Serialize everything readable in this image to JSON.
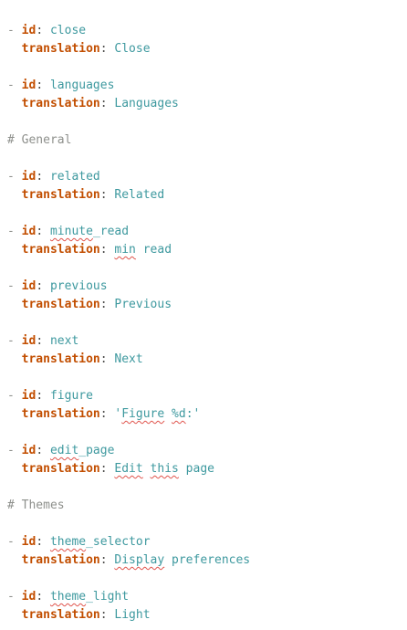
{
  "editor": {
    "lines": [
      {
        "type": "id",
        "value": "close"
      },
      {
        "type": "translation",
        "value": "Close"
      },
      {
        "type": "blank"
      },
      {
        "type": "id",
        "value": "languages"
      },
      {
        "type": "translation",
        "value": "Languages"
      },
      {
        "type": "blank"
      },
      {
        "type": "comment",
        "value": "# General"
      },
      {
        "type": "blank"
      },
      {
        "type": "id",
        "value": "related"
      },
      {
        "type": "translation",
        "value": "Related"
      },
      {
        "type": "blank"
      },
      {
        "type": "id",
        "value": "minute_read",
        "spellcheck": [
          "minute"
        ]
      },
      {
        "type": "translation",
        "value": "min read",
        "spellcheck": [
          "min"
        ]
      },
      {
        "type": "blank"
      },
      {
        "type": "id",
        "value": "previous"
      },
      {
        "type": "translation",
        "value": "Previous"
      },
      {
        "type": "blank"
      },
      {
        "type": "id",
        "value": "next"
      },
      {
        "type": "translation",
        "value": "Next"
      },
      {
        "type": "blank"
      },
      {
        "type": "id",
        "value": "figure"
      },
      {
        "type": "translation",
        "value": "'Figure %d:'",
        "spellcheck": [
          "Figure",
          "%d"
        ]
      },
      {
        "type": "blank"
      },
      {
        "type": "id",
        "value": "edit_page",
        "spellcheck": [
          "edit"
        ]
      },
      {
        "type": "translation",
        "value": "Edit this page",
        "spellcheck": [
          "Edit",
          "this"
        ]
      },
      {
        "type": "blank"
      },
      {
        "type": "comment",
        "value": "# Themes"
      },
      {
        "type": "blank"
      },
      {
        "type": "id",
        "value": "theme_selector",
        "spellcheck": [
          "theme"
        ]
      },
      {
        "type": "translation",
        "value": "Display preferences",
        "spellcheck": [
          "Display"
        ]
      },
      {
        "type": "blank"
      },
      {
        "type": "id",
        "value": "theme_light",
        "spellcheck": [
          "theme"
        ]
      },
      {
        "type": "translation",
        "value": "Light"
      }
    ],
    "labels": {
      "dash": "-",
      "id_key": "id",
      "translation_key": "translation",
      "colon": ":"
    },
    "colors": {
      "key": "#c24e00",
      "value": "#3e999f",
      "comment": "#8e908c",
      "spellcheck": "#e0544c"
    }
  }
}
